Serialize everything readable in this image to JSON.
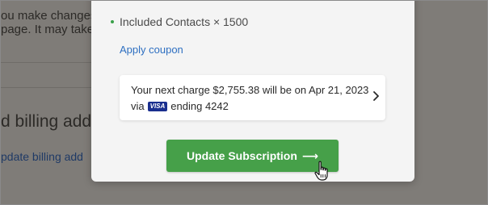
{
  "background": {
    "notice_line1": "ou make changes",
    "notice_line2": "page. It may take",
    "section_heading": "d billing add",
    "section_link": "pdate billing add"
  },
  "modal": {
    "included_contacts": "Included Contacts × 1500",
    "apply_coupon": "Apply coupon",
    "charge": {
      "line1": "Your next charge $2,755.38 will be on Apr 21, 2023",
      "via": "via",
      "card_brand": "VISA",
      "ending": "ending 4242"
    },
    "update_button": "Update Subscription",
    "update_button_arrow": "⟶"
  },
  "colors": {
    "accent_green": "#46a049",
    "link_blue": "#2e6fc1",
    "visa_blue": "#1a2f8f"
  },
  "icons": {
    "chevron": "chevron-right-icon",
    "cursor": "hand-pointer-icon",
    "bullet": "green-dot-icon"
  }
}
